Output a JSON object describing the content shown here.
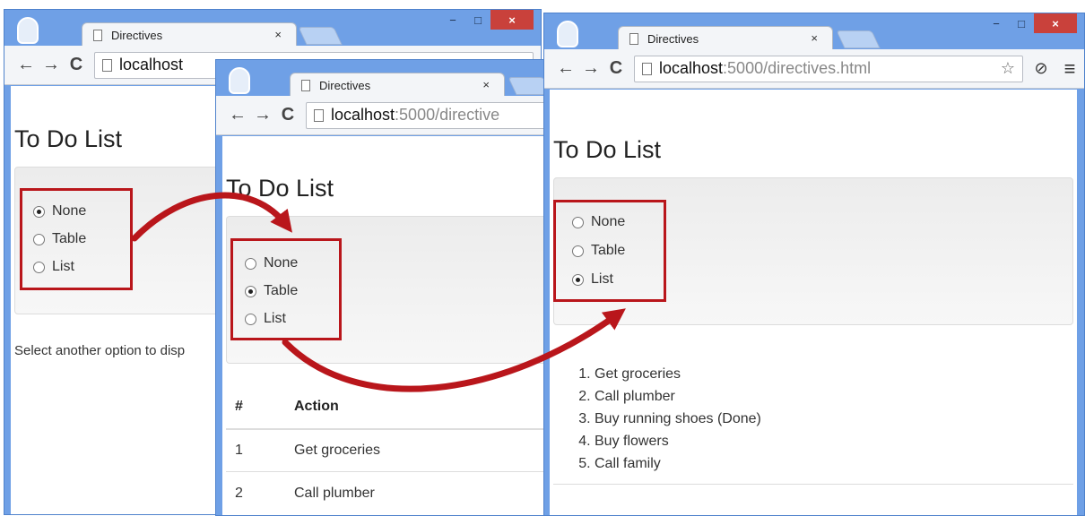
{
  "windows": {
    "left": {
      "tab_title": "Directives",
      "tab_close": "×",
      "url_host": "localhost",
      "url_path": "",
      "heading": "To Do List",
      "options": [
        "None",
        "Table",
        "List"
      ],
      "selected": "None",
      "message": "Select another option to disp"
    },
    "middle": {
      "tab_title": "Directives",
      "tab_close": "×",
      "url_host": "localhost",
      "url_path": ":5000/directive",
      "heading": "To Do List",
      "options": [
        "None",
        "Table",
        "List"
      ],
      "selected": "Table",
      "table": {
        "headers": [
          "#",
          "Action"
        ],
        "rows": [
          [
            "1",
            "Get groceries"
          ],
          [
            "2",
            "Call plumber"
          ]
        ]
      }
    },
    "right": {
      "tab_title": "Directives",
      "tab_close": "×",
      "url_host": "localhost",
      "url_path": ":5000/directives.html",
      "heading": "To Do List",
      "options": [
        "None",
        "Table",
        "List"
      ],
      "selected": "List",
      "list_items": [
        "Get groceries",
        "Call plumber",
        "Buy running shoes (Done)",
        "Buy flowers",
        "Call family"
      ]
    }
  },
  "icons": {
    "back": "←",
    "forward": "→",
    "reload": "C",
    "star": "☆",
    "extension": "⊘",
    "menu": "≡",
    "minimize": "−",
    "maximize": "□",
    "close": "×"
  },
  "colors": {
    "highlight": "#b9161b",
    "window_frame": "#6fa0e6"
  }
}
